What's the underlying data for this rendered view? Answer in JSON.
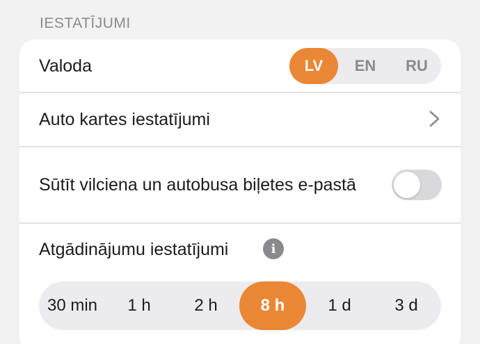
{
  "section": {
    "title": "IESTATĪJUMI"
  },
  "language": {
    "label": "Valoda",
    "options": [
      "LV",
      "EN",
      "RU"
    ],
    "selected": "LV"
  },
  "car_card": {
    "label": "Auto kartes iestatījumi"
  },
  "tickets": {
    "label": "Sūtīt vilciena un autobusa biļetes e-pastā",
    "enabled": false
  },
  "reminders": {
    "label": "Atgādinājumu iestatījumi",
    "info_icon": "info-icon",
    "options": [
      "30 min",
      "1 h",
      "2 h",
      "8 h",
      "1 d",
      "3 d"
    ],
    "selected": "8 h"
  },
  "colors": {
    "accent": "#ea8735",
    "background": "#f2f2f2",
    "card": "#ffffff",
    "muted": "#8a8a8e"
  }
}
